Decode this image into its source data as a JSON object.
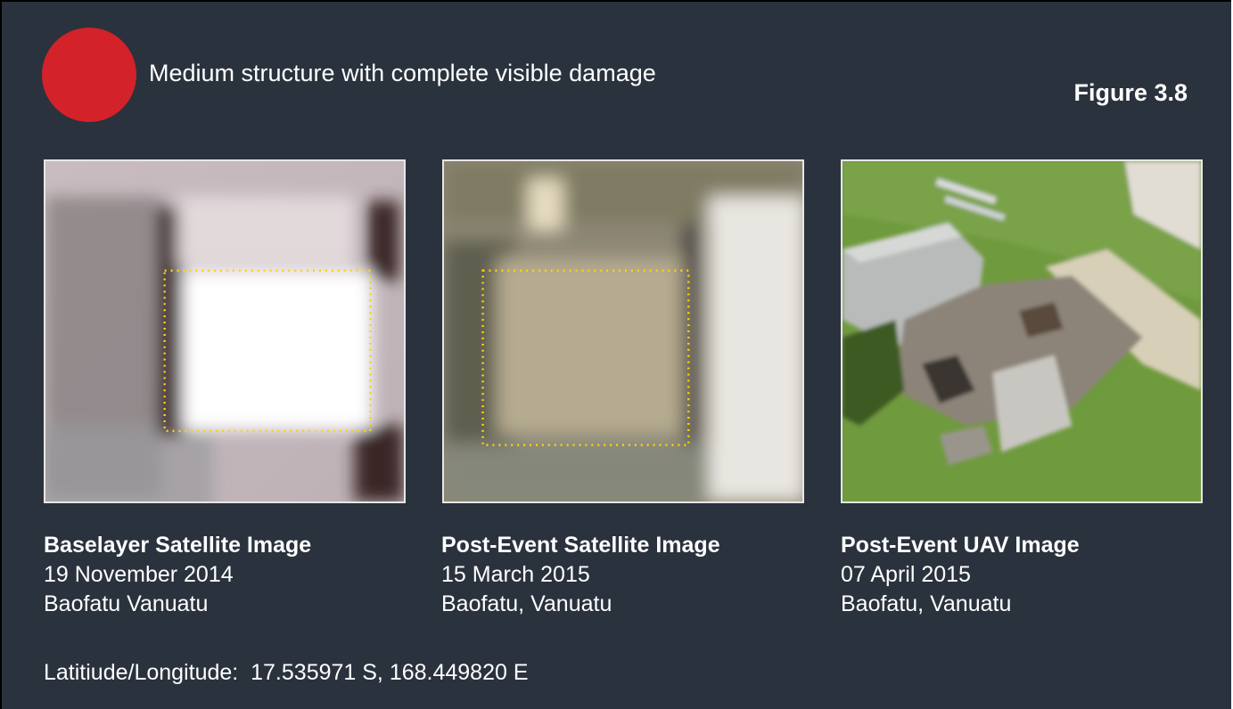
{
  "legend": {
    "marker_color": "#d32229",
    "marker_icon": "red-circle-damage-marker",
    "caption": "Medium structure with complete visible damage"
  },
  "figure_label": "Figure 3.8",
  "panels": [
    {
      "title": "Baselayer Satellite Image",
      "date": "19 November 2014",
      "location": "Baofatu Vanuatu",
      "image": "satellite image of intact building outlined by dotted yellow box"
    },
    {
      "title": "Post-Event Satellite Image",
      "date": "15 March 2015",
      "location": "Baofatu, Vanuatu",
      "image": "satellite image of damaged building area outlined by dotted yellow box"
    },
    {
      "title": "Post-Event UAV Image",
      "date": "07 April 2015",
      "location": "Baofatu, Vanuatu",
      "image": "aerial drone photo of collapsed roofless structure with debris on grass"
    }
  ],
  "coordinates": "Latitiude/Longitude:  17.535971 S, 168.449820 E",
  "colors": {
    "background": "#2a323d",
    "text": "#ffffff",
    "highlight_box": "#ffd400",
    "frame_border": "#e6e6e6"
  }
}
